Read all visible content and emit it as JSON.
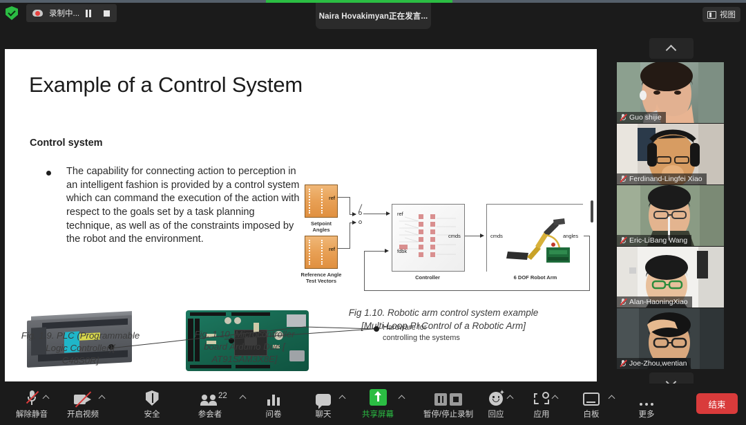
{
  "window": {
    "recording_status_label": "录制中...",
    "active_speaker_chip": "Naira  Hovakimyan正在发言...",
    "view_button_label": "视图"
  },
  "slide": {
    "title": "Example of a Control System",
    "section_heading": "Control system",
    "bullet": "The capability for connecting action to perception in an intelligent fashion is provided by a control system which can command the execution of the action with respect to the goals set by a task planning technique, as well as of the constraints imposed by the robot and the environment.",
    "diagram": {
      "block_setpoint": "Setpoint\nAngles",
      "block_reference": "Reference Angle\nTest Vectors",
      "ramp_port_label": "ref",
      "controller_block": "Controller",
      "robot_block": "6 DOF Robot Arm",
      "port_ref": "ref",
      "port_fdbk": "fdbk",
      "port_cmds_out": "cmds",
      "port_cmds_in": "cmds",
      "port_angles": "angles"
    },
    "caption_diagram_line1": "Fig 1.10. Robotic arm  control system example",
    "caption_diagram_line2": "[Multi-Loop PI Control of a Robotic Arm]",
    "caption_plc_line1": "Fig. 1.9. PLC (Programmable",
    "caption_plc_line2": "Logic Controller)[",
    "caption_plc_line3": "C48S0R]",
    "caption_arduino_line1": "Fig. 1.10. Microcontroller",
    "caption_arduino_line2": "board Arduino Due [",
    "caption_arduino_line3": "AT91SAM3X8E]",
    "callout_line1": "Hardware for",
    "callout_line2": "controlling the systems"
  },
  "filmstrip": {
    "scroll_up_label": "scroll-up",
    "scroll_down_label": "scroll-down",
    "participants": [
      {
        "name": "Guo shijie",
        "muted": true
      },
      {
        "name": "Ferdinand-Lingfei Xiao",
        "muted": true
      },
      {
        "name": "Eric-LiBang Wang",
        "muted": true
      },
      {
        "name": "Alan-HaoningXiao",
        "muted": true
      },
      {
        "name": "Joe-Zhou,wentian",
        "muted": true
      }
    ]
  },
  "toolbar": {
    "items": [
      {
        "label": "解除静音",
        "icon": "mic-muted-icon",
        "caret": true,
        "badge": ""
      },
      {
        "label": "开启视频",
        "icon": "camera-off-icon",
        "caret": true,
        "badge": ""
      },
      {
        "label": "安全",
        "icon": "shield-icon",
        "caret": false,
        "badge": ""
      },
      {
        "label": "参会者",
        "icon": "participants-icon",
        "caret": true,
        "badge": "22"
      },
      {
        "label": "问卷",
        "icon": "poll-icon",
        "caret": false,
        "badge": ""
      },
      {
        "label": "聊天",
        "icon": "chat-icon",
        "caret": true,
        "badge": ""
      },
      {
        "label": "共享屏幕",
        "icon": "share-screen-icon",
        "caret": true,
        "badge": "",
        "active": true
      },
      {
        "label": "暂停/停止录制",
        "icon": "pause-stop-record-icon",
        "caret": false,
        "badge": ""
      },
      {
        "label": "回应",
        "icon": "reactions-icon",
        "caret": true,
        "badge": ""
      },
      {
        "label": "应用",
        "icon": "apps-icon",
        "caret": true,
        "badge": ""
      },
      {
        "label": "白板",
        "icon": "whiteboard-icon",
        "caret": true,
        "badge": ""
      },
      {
        "label": "更多",
        "icon": "more-icon",
        "caret": false,
        "badge": ""
      }
    ],
    "end_button_label": "结束"
  },
  "colors": {
    "accent_green": "#2bbd43",
    "end_red": "#d93b3b",
    "toolbar_bg": "#1b1b1b",
    "slide_bg": "#ffffff"
  }
}
